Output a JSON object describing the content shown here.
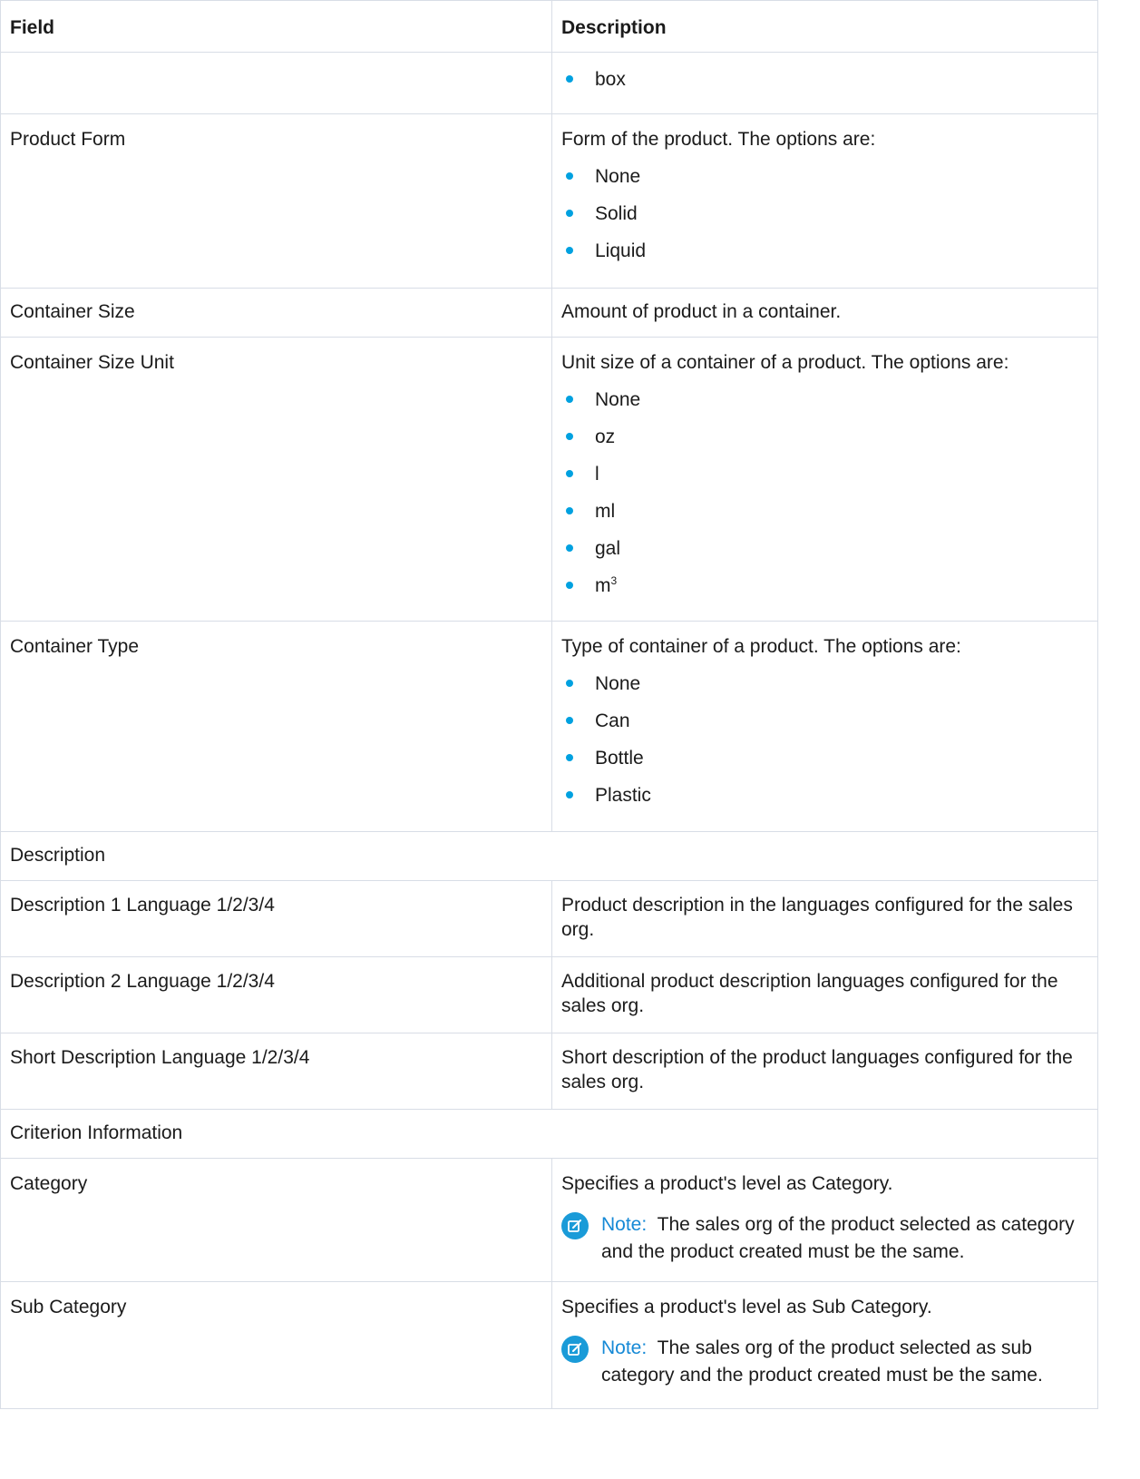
{
  "header": {
    "field": "Field",
    "description": "Description"
  },
  "rows": {
    "r0": {
      "bullets": [
        "box"
      ]
    },
    "product_form": {
      "field": "Product Form",
      "intro": "Form of the product. The options are:",
      "bullets": [
        "None",
        "Solid",
        "Liquid"
      ]
    },
    "container_size": {
      "field": "Container Size",
      "desc": "Amount of product in a container."
    },
    "container_size_unit": {
      "field": "Container Size Unit",
      "intro": "Unit size of a container of a product. The options are:",
      "bullets": [
        "None",
        "oz",
        "l",
        "ml",
        "gal",
        "m"
      ],
      "last_sup": "3"
    },
    "container_type": {
      "field": "Container Type",
      "intro": "Type of container of a product. The options are:",
      "bullets": [
        "None",
        "Can",
        "Bottle",
        "Plastic"
      ]
    },
    "section_description": {
      "label": "Description"
    },
    "desc1": {
      "field": "Description 1 Language 1/2/3/4",
      "desc": "Product description in the languages configured for the sales org."
    },
    "desc2": {
      "field": "Description 2 Language 1/2/3/4",
      "desc": "Additional product description languages configured for the sales org."
    },
    "short_desc": {
      "field": "Short Description Language 1/2/3/4",
      "desc": "Short description of the product languages configured for the sales org."
    },
    "section_criterion": {
      "label": "Criterion Information"
    },
    "category": {
      "field": "Category",
      "desc": "Specifies a product's level as Category.",
      "note_label": "Note:",
      "note": "The sales org of the product selected as category and the product created must be the same."
    },
    "sub_category": {
      "field": "Sub Category",
      "desc": "Specifies a product's level as Sub Category.",
      "note_label": "Note:",
      "note": "The sales org of the product selected as sub category and the product created must be the same."
    }
  },
  "icons": {
    "note": "note-edit-icon",
    "bullet": "bullet-dot-icon"
  },
  "colors": {
    "bullet": "#00a1e0",
    "note_label": "#1589d6",
    "note_icon": "#1a9bd8",
    "border": "#d8dde6"
  }
}
